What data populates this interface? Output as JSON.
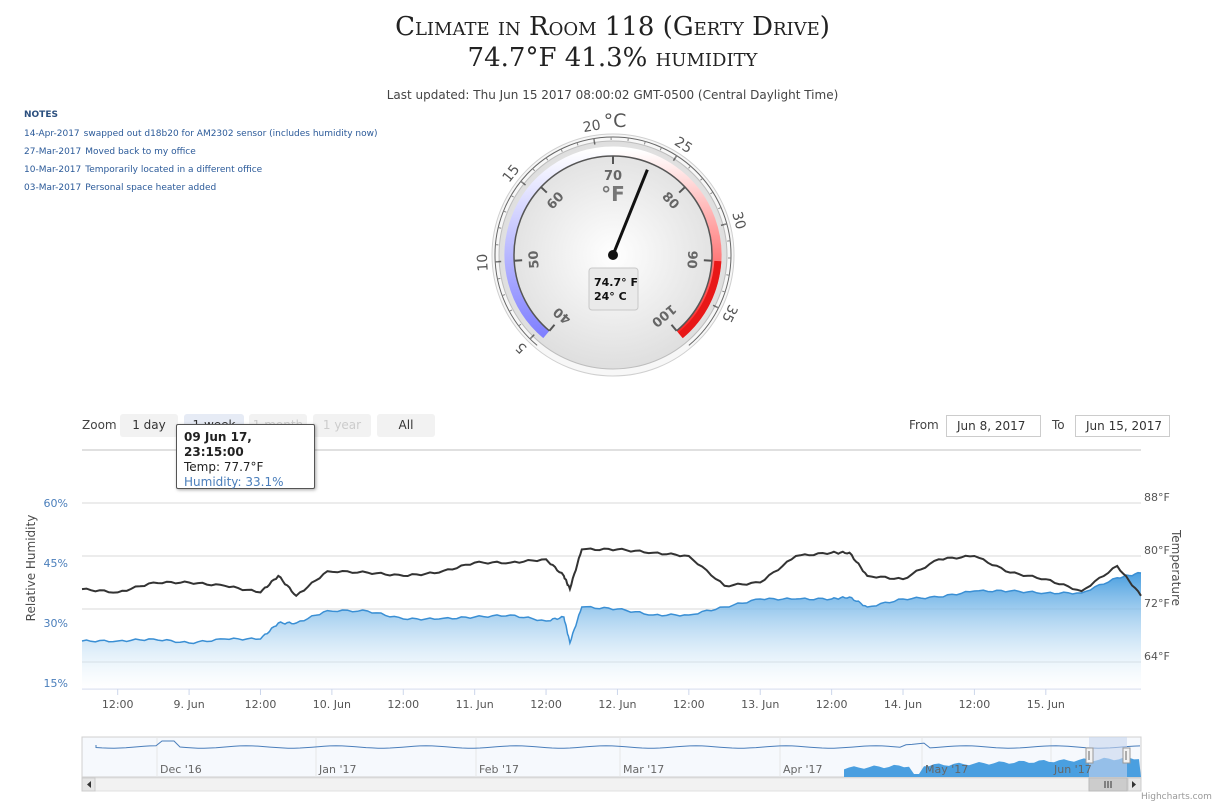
{
  "header": {
    "title_line1": "Climate in Room 118 (Gerty Drive)",
    "title_line2": "74.7°F 41.3% humidity",
    "last_updated": "Last updated: Thu Jun 15 2017 08:00:02 GMT-0500 (Central Daylight Time)"
  },
  "notes": {
    "title": "NOTES",
    "items": [
      {
        "date": "14-Apr-2017",
        "text": "swapped out d18b20 for AM2302 sensor (includes humidity now)"
      },
      {
        "date": "27-Mar-2017",
        "text": "Moved back to my office"
      },
      {
        "date": "10-Mar-2017",
        "text": "Temporarily located in a different office"
      },
      {
        "date": "03-Mar-2017",
        "text": "Personal space heater added"
      }
    ]
  },
  "gauge": {
    "outer_unit": "°C",
    "inner_unit": "°F",
    "outer_ticks": [
      "5",
      "10",
      "15",
      "20",
      "25",
      "30",
      "35"
    ],
    "inner_ticks": [
      "40",
      "50",
      "60",
      "70",
      "80",
      "90",
      "100"
    ],
    "value_f": 74.7,
    "readout_f": "74.7° F",
    "readout_c": "24° C",
    "cold_color": "#8080ff",
    "hot_color": "#ff2020"
  },
  "range_selector": {
    "zoom_label": "Zoom",
    "buttons": [
      {
        "label": "1 day",
        "state": "normal"
      },
      {
        "label": "1 week",
        "state": "active"
      },
      {
        "label": "1 month",
        "state": "disabled"
      },
      {
        "label": "1 year",
        "state": "disabled"
      },
      {
        "label": "All",
        "state": "normal"
      }
    ],
    "from_label": "From",
    "from_value": "Jun 8, 2017",
    "to_label": "To",
    "to_value": "Jun 15, 2017"
  },
  "tooltip": {
    "title": "09 Jun 17, 23:15:00",
    "temp": "Temp: 77.7°F",
    "humidity": "Humidity: 33.1%"
  },
  "chart_data": {
    "type": "area",
    "xlabel": "",
    "x_ticks": [
      "12:00",
      "9. Jun",
      "12:00",
      "10. Jun",
      "12:00",
      "11. Jun",
      "12:00",
      "12. Jun",
      "12:00",
      "13. Jun",
      "12:00",
      "14. Jun",
      "12:00",
      "15. Jun"
    ],
    "y_left": {
      "label": "Relative Humidity",
      "ticks": [
        "60%",
        "45%",
        "30%",
        "15%"
      ],
      "range": [
        15,
        60
      ]
    },
    "y_right": {
      "label": "Temperature",
      "ticks": [
        "88°F",
        "80°F",
        "72°F",
        "64°F"
      ],
      "range": [
        64,
        88
      ]
    },
    "x_range": [
      "2017-06-08 06:00",
      "2017-06-15 16:00"
    ],
    "grid": true,
    "series": [
      {
        "name": "Humidity",
        "color": "#4a9fe0",
        "x": [
          "2017-06-08 06:00",
          "2017-06-08 12:00",
          "2017-06-08 18:00",
          "2017-06-09 00:00",
          "2017-06-09 06:00",
          "2017-06-09 12:00",
          "2017-06-09 15:00",
          "2017-06-09 18:00",
          "2017-06-09 23:15",
          "2017-06-10 06:00",
          "2017-06-10 12:00",
          "2017-06-10 18:00",
          "2017-06-11 00:00",
          "2017-06-11 06:00",
          "2017-06-11 12:00",
          "2017-06-11 15:00",
          "2017-06-11 16:00",
          "2017-06-11 18:00",
          "2017-06-12 00:00",
          "2017-06-12 06:00",
          "2017-06-12 12:00",
          "2017-06-12 18:00",
          "2017-06-13 00:00",
          "2017-06-13 06:00",
          "2017-06-13 12:00",
          "2017-06-13 15:00",
          "2017-06-13 18:00",
          "2017-06-14 00:00",
          "2017-06-14 06:00",
          "2017-06-14 12:00",
          "2017-06-14 18:00",
          "2017-06-15 00:00",
          "2017-06-15 06:00",
          "2017-06-15 12:00",
          "2017-06-15 16:00"
        ],
        "values": [
          25.5,
          25.5,
          26,
          25,
          26,
          26,
          30,
          30,
          33.1,
          33,
          31,
          31,
          31.5,
          32,
          30.5,
          31.5,
          25,
          34,
          33.5,
          32,
          32,
          34,
          36,
          36,
          36,
          36.5,
          34,
          36,
          36.5,
          38,
          38,
          37.5,
          37.5,
          41.3,
          42.5
        ]
      },
      {
        "name": "Temp",
        "color": "#333333",
        "x": [
          "2017-06-08 06:00",
          "2017-06-08 12:00",
          "2017-06-08 18:00",
          "2017-06-09 00:00",
          "2017-06-09 06:00",
          "2017-06-09 12:00",
          "2017-06-09 15:00",
          "2017-06-09 18:00",
          "2017-06-09 23:15",
          "2017-06-10 06:00",
          "2017-06-10 12:00",
          "2017-06-10 18:00",
          "2017-06-11 00:00",
          "2017-06-11 06:00",
          "2017-06-11 12:00",
          "2017-06-11 15:00",
          "2017-06-11 16:00",
          "2017-06-11 18:00",
          "2017-06-12 00:00",
          "2017-06-12 06:00",
          "2017-06-12 12:00",
          "2017-06-12 18:00",
          "2017-06-13 00:00",
          "2017-06-13 06:00",
          "2017-06-13 12:00",
          "2017-06-13 15:00",
          "2017-06-13 18:00",
          "2017-06-14 00:00",
          "2017-06-14 06:00",
          "2017-06-14 12:00",
          "2017-06-14 18:00",
          "2017-06-15 00:00",
          "2017-06-15 06:00",
          "2017-06-15 12:00",
          "2017-06-15 16:00"
        ],
        "values": [
          75,
          74.5,
          76,
          76,
          75.5,
          74.5,
          77,
          74,
          77.7,
          77.5,
          77,
          77.5,
          79,
          79,
          79.5,
          77,
          75,
          81,
          81,
          80.5,
          80,
          75.5,
          76,
          80,
          80.5,
          80.5,
          77,
          76.5,
          79.5,
          80,
          77.5,
          76.5,
          74.7,
          78.5,
          74
        ]
      }
    ]
  },
  "navigator": {
    "labels": [
      "Dec '16",
      "Jan '17",
      "Feb '17",
      "Mar '17",
      "Apr '17",
      "May '17",
      "Jun '17"
    ],
    "mask_fill": "#c8d5ee"
  },
  "credits": "Highcharts.com"
}
